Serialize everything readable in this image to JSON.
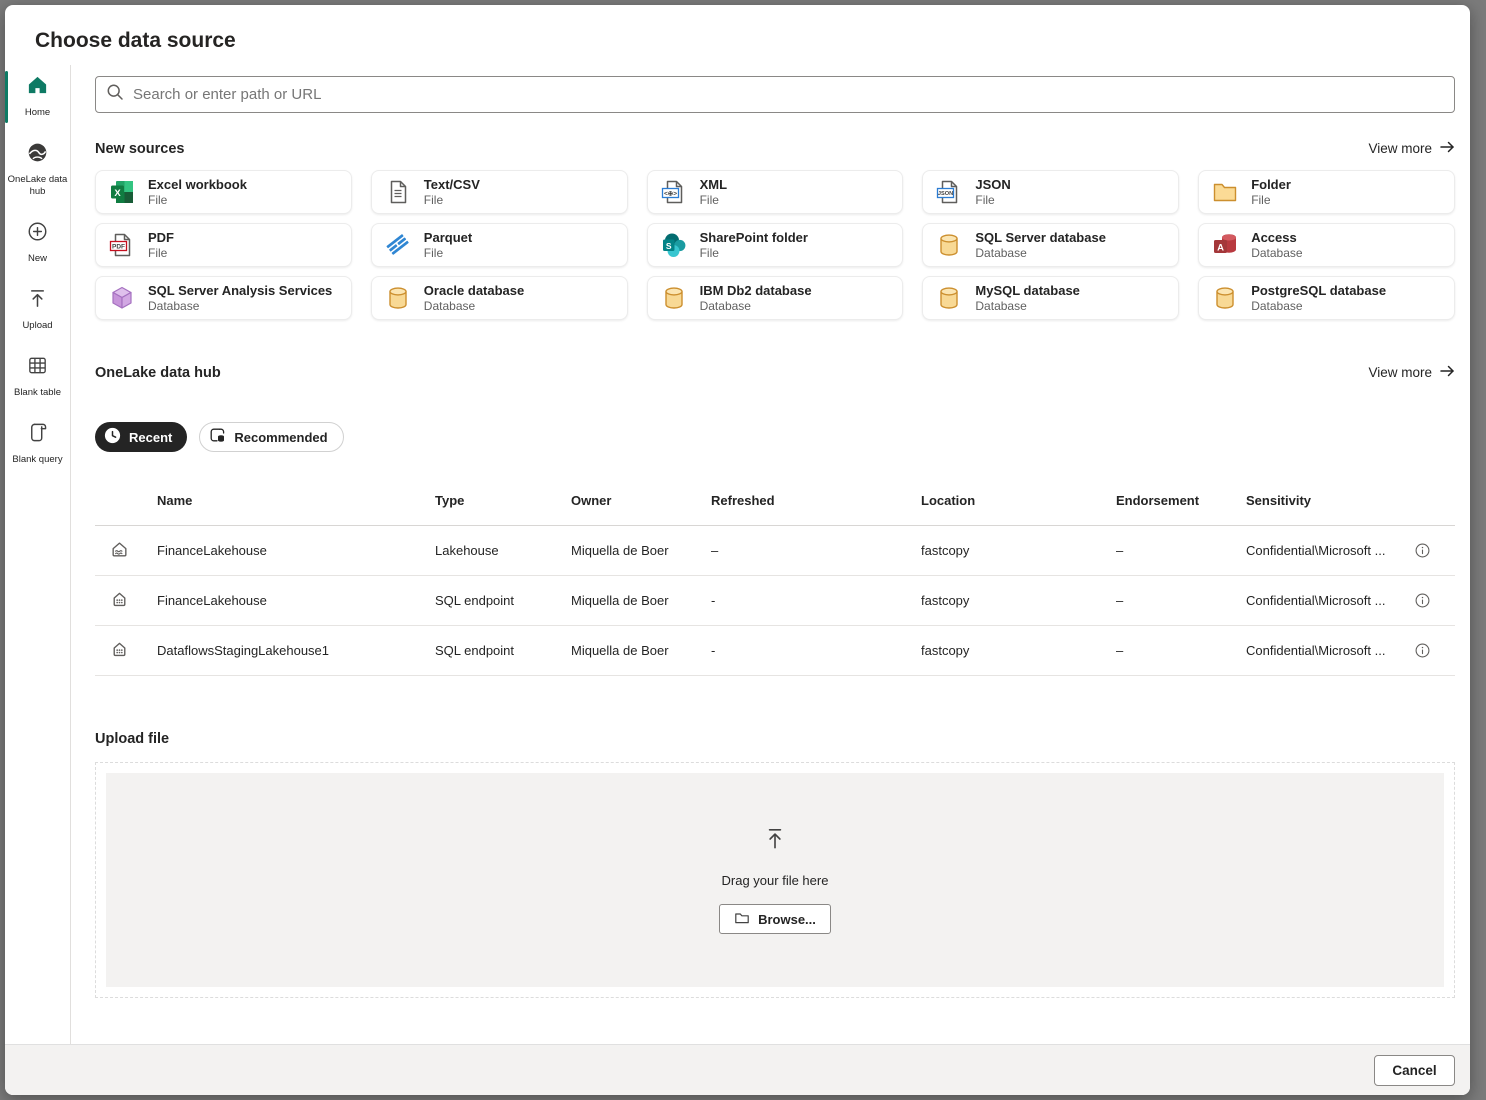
{
  "dialog": {
    "title": "Choose data source",
    "cancel_label": "Cancel"
  },
  "colors": {
    "accent_teal": "#0e7a64",
    "pill_selected_bg": "#242424",
    "footer_bg": "#f3f2f1"
  },
  "sidebar": {
    "items": [
      {
        "label": "Home",
        "selected": true
      },
      {
        "label": "OneLake data hub",
        "selected": false
      },
      {
        "label": "New",
        "selected": false
      },
      {
        "label": "Upload",
        "selected": false
      },
      {
        "label": "Blank table",
        "selected": false
      },
      {
        "label": "Blank query",
        "selected": false
      }
    ]
  },
  "search": {
    "placeholder": "Search or enter path or URL"
  },
  "new_sources": {
    "heading": "New sources",
    "view_more": "View more",
    "tiles": [
      {
        "name": "Excel workbook",
        "kind": "File"
      },
      {
        "name": "Text/CSV",
        "kind": "File"
      },
      {
        "name": "XML",
        "kind": "File"
      },
      {
        "name": "JSON",
        "kind": "File"
      },
      {
        "name": "Folder",
        "kind": "File"
      },
      {
        "name": "PDF",
        "kind": "File"
      },
      {
        "name": "Parquet",
        "kind": "File"
      },
      {
        "name": "SharePoint folder",
        "kind": "File"
      },
      {
        "name": "SQL Server database",
        "kind": "Database"
      },
      {
        "name": "Access",
        "kind": "Database"
      },
      {
        "name": "SQL Server Analysis Services",
        "kind": "Database"
      },
      {
        "name": "Oracle database",
        "kind": "Database"
      },
      {
        "name": "IBM Db2 database",
        "kind": "Database"
      },
      {
        "name": "MySQL database",
        "kind": "Database"
      },
      {
        "name": "PostgreSQL database",
        "kind": "Database"
      }
    ]
  },
  "onelake": {
    "heading": "OneLake data hub",
    "view_more": "View more",
    "filters": {
      "recent": "Recent",
      "recommended": "Recommended"
    },
    "table": {
      "columns": [
        "Name",
        "Type",
        "Owner",
        "Refreshed",
        "Location",
        "Endorsement",
        "Sensitivity"
      ],
      "rows": [
        {
          "name": "FinanceLakehouse",
          "type": "Lakehouse",
          "owner": "Miquella de Boer",
          "refreshed": "–",
          "location": "fastcopy",
          "endorsement": "–",
          "sensitivity": "Confidential\\Microsoft ..."
        },
        {
          "name": "FinanceLakehouse",
          "type": "SQL endpoint",
          "owner": "Miquella de Boer",
          "refreshed": "-",
          "location": "fastcopy",
          "endorsement": "–",
          "sensitivity": "Confidential\\Microsoft ..."
        },
        {
          "name": "DataflowsStagingLakehouse1",
          "type": "SQL endpoint",
          "owner": "Miquella de Boer",
          "refreshed": "-",
          "location": "fastcopy",
          "endorsement": "–",
          "sensitivity": "Confidential\\Microsoft ..."
        }
      ]
    }
  },
  "upload": {
    "heading": "Upload file",
    "drag_text": "Drag your file here",
    "browse_label": "Browse..."
  }
}
